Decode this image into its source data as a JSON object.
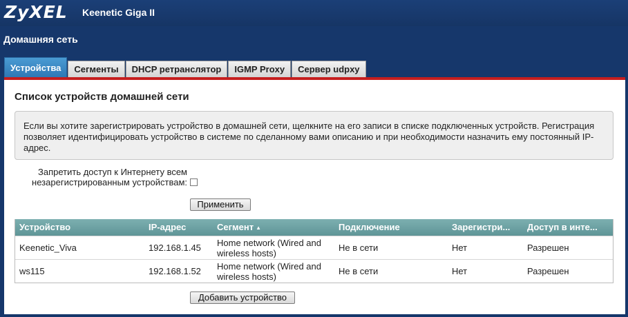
{
  "header": {
    "logo": "ZyXEL",
    "model": "Keenetic Giga II"
  },
  "section_title": "Домашняя сеть",
  "tabs": [
    {
      "label": "Устройства",
      "active": true
    },
    {
      "label": "Сегменты",
      "active": false
    },
    {
      "label": "DHCP ретранслятор",
      "active": false
    },
    {
      "label": "IGMP Proxy",
      "active": false
    },
    {
      "label": "Сервер udpxy",
      "active": false
    }
  ],
  "panel": {
    "title": "Список устройств домашней сети",
    "info_text": "Если вы хотите зарегистрировать устройство в домашней сети, щелкните на его записи в списке подключенных устройств. Регистрация позволяет идентифицировать устройство в системе по сделанному вами описанию и при необходимости назначить ему постоянный IP-адрес.",
    "block_label_line1": "Запретить доступ к Интернету всем",
    "block_label_line2": "незарегистрированным устройствам:",
    "block_checked": false,
    "apply_button": "Применить",
    "add_button": "Добавить устройство"
  },
  "table": {
    "columns": [
      "Устройство",
      "IP-адрес",
      "Сегмент",
      "Подключение",
      "Зарегистри...",
      "Доступ в инте..."
    ],
    "sort_indicator": "▲",
    "rows": [
      [
        "Keenetic_Viva",
        "192.168.1.45",
        "Home network (Wired and wireless hosts)",
        "Не в сети",
        "Нет",
        "Разрешен"
      ],
      [
        "ws115",
        "192.168.1.52",
        "Home network (Wired and wireless hosts)",
        "Не в сети",
        "Нет",
        "Разрешен"
      ]
    ]
  },
  "colors": {
    "page_bg": "#16376b",
    "active_tab": "#3a87c4",
    "tab_underline": "#c61e1e",
    "table_header": "#6fa2a4"
  }
}
